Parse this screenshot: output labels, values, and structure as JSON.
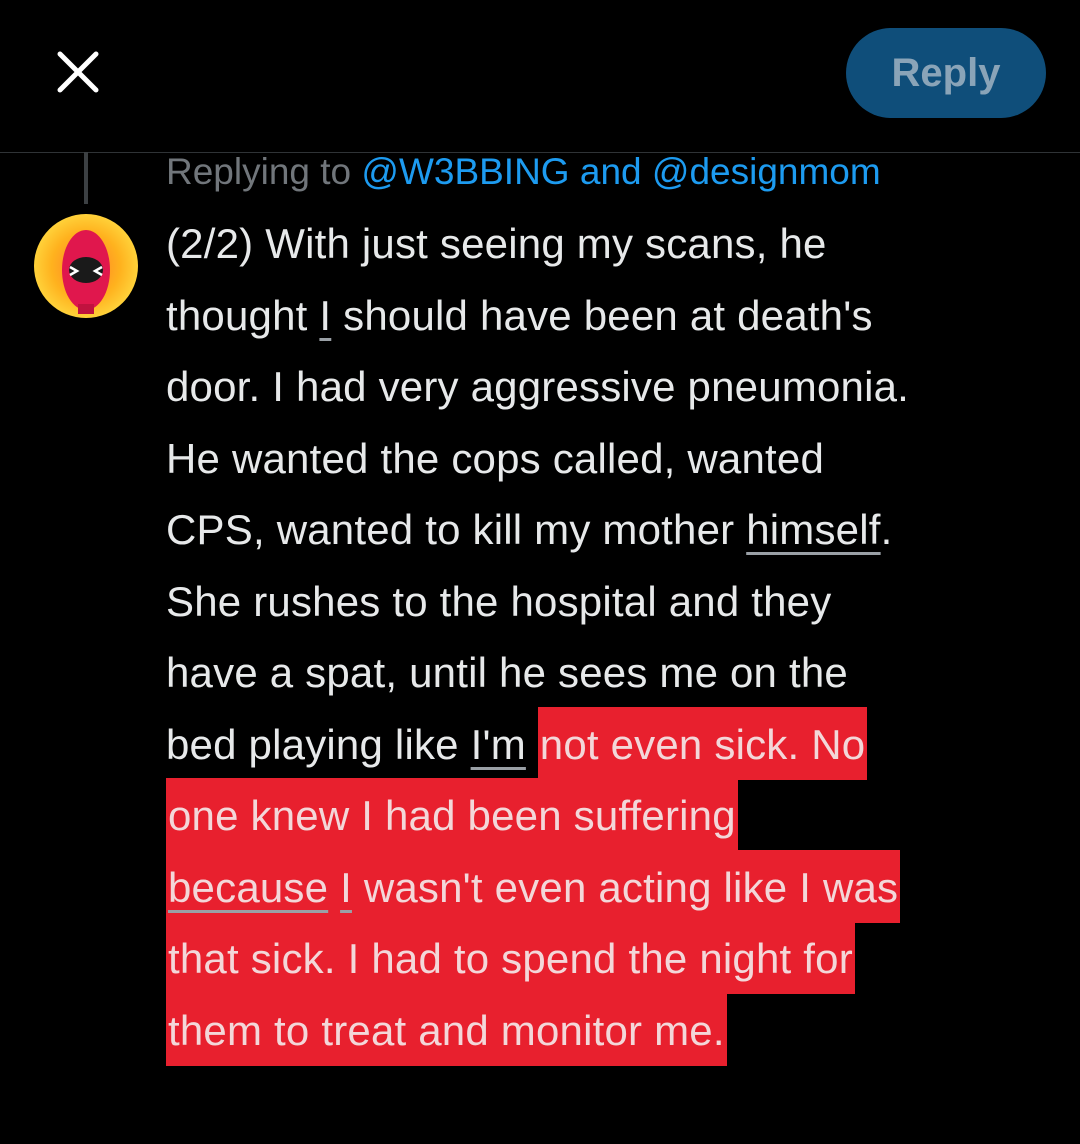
{
  "header": {
    "close_icon": "close-icon",
    "reply_button_label": "Reply",
    "reply_button_color": "#0f4e7a"
  },
  "replying": {
    "prefix": "Replying to",
    "mention_1": "@W3BBING",
    "conjunction": "and",
    "mention_2": "@designmom"
  },
  "avatar": {
    "icon": "deadpool-avatar-icon"
  },
  "tweet": {
    "l1": "(2/2) With just seeing my scans, he",
    "l2_a": "thought ",
    "l2_u": "I",
    "l2_b": " should have been at death's",
    "l3": "door. I had very aggressive pneumonia.",
    "l4": "He wanted the cops called, wanted",
    "l5_a": "CPS, wanted to kill my mother ",
    "l5_u": "himself",
    "l5_b": ".",
    "l6": "She rushes to the hospital and they",
    "l7": "have a spat, until he sees me on the",
    "l8_a": "bed playing like ",
    "l8_u": "I'm",
    "l8_b": " ",
    "l8_hl": "not even sick. No",
    "l9_hl": "one knew I had been suffering",
    "l10_u": "because",
    "l10_sp": " ",
    "l10_u2": "I",
    "l10_hl": " wasn't even acting like I was",
    "l11_hl": "that sick. I had to spend the night for",
    "l12_hl": "them to treat and monitor me.",
    "highlight_color": "#e8202e",
    "mention_color": "#1d9bf0"
  }
}
